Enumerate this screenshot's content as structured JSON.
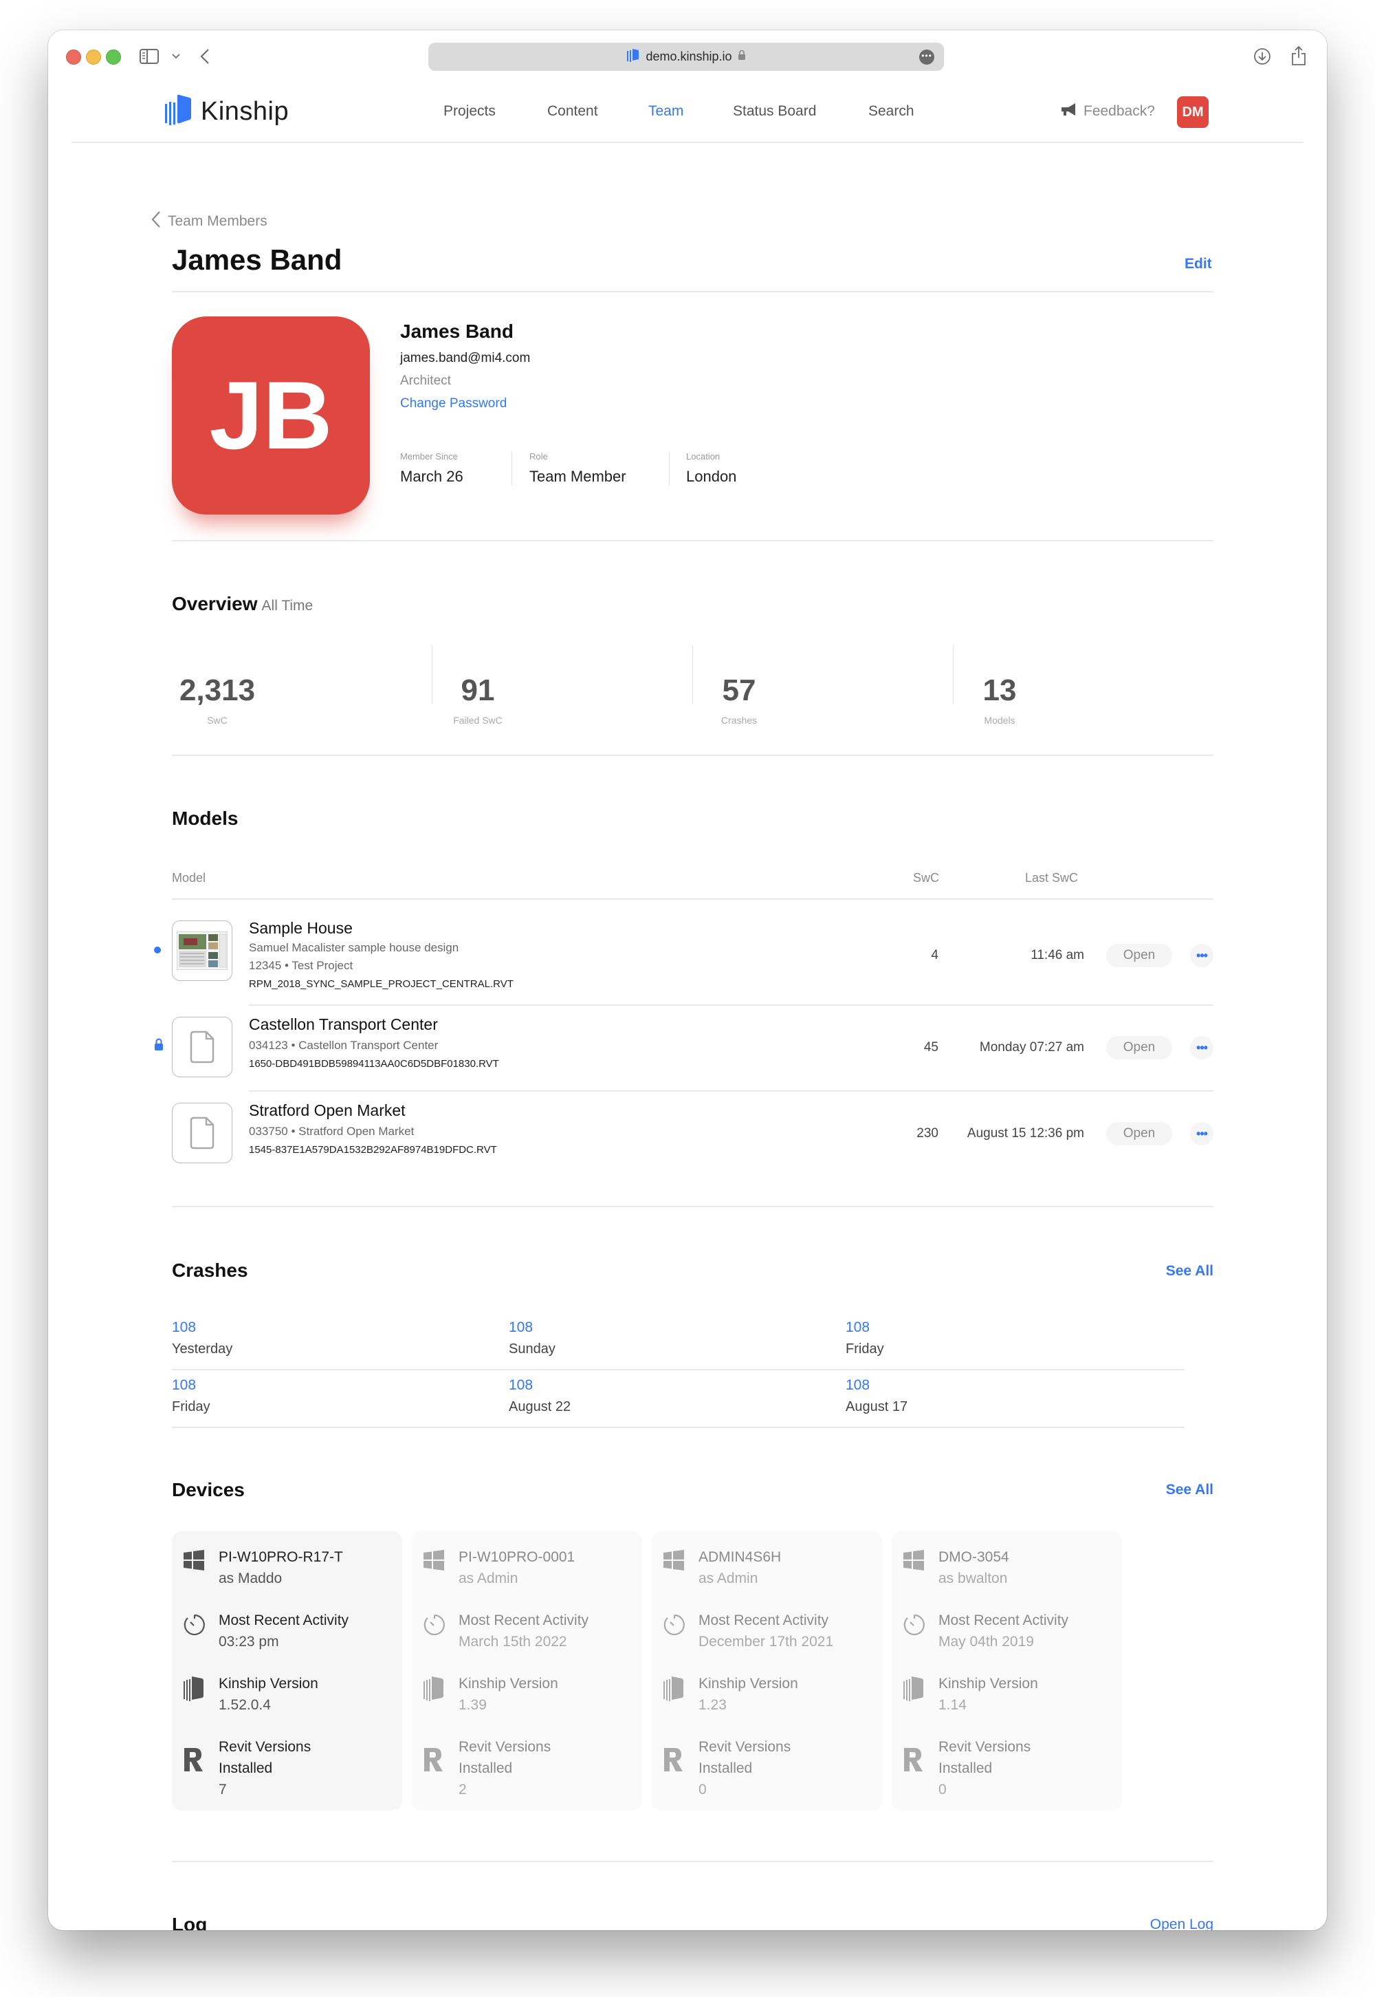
{
  "browser": {
    "url": "demo.kinship.io",
    "icons": [
      "sidebar-icon",
      "chevron-down-icon",
      "back-icon",
      "lock-icon",
      "more-icon",
      "download-icon",
      "share-icon",
      "new-tab-icon"
    ]
  },
  "brand": {
    "name": "Kinship",
    "accent": "#3478f6"
  },
  "nav": {
    "items": [
      {
        "label": "Projects",
        "active": false
      },
      {
        "label": "Content",
        "active": false
      },
      {
        "label": "Team",
        "active": true
      },
      {
        "label": "Status Board",
        "active": false
      },
      {
        "label": "Search",
        "active": false
      }
    ],
    "feedback": "Feedback?",
    "user_initials": "DM"
  },
  "header": {
    "breadcrumb": "Team Members",
    "title": "James Band",
    "edit": "Edit"
  },
  "profile": {
    "initials": "JB",
    "avatar_color": "#df4840",
    "name": "James Band",
    "email": "james.band@mi4.com",
    "job_title": "Architect",
    "change_password": "Change Password",
    "meta": [
      {
        "label": "Member Since",
        "value": "March 26"
      },
      {
        "label": "Role",
        "value": "Team Member"
      },
      {
        "label": "Location",
        "value": "London"
      }
    ]
  },
  "overview": {
    "title": "Overview",
    "subtitle": "All Time",
    "stats": [
      {
        "value": "2,313",
        "label": "SwC"
      },
      {
        "value": "91",
        "label": "Failed SwC"
      },
      {
        "value": "57",
        "label": "Crashes"
      },
      {
        "value": "13",
        "label": "Models"
      }
    ]
  },
  "models": {
    "title": "Models",
    "columns": {
      "model": "Model",
      "swc": "SwC",
      "last_swc": "Last SwC"
    },
    "open_label": "Open",
    "rows": [
      {
        "name": "Sample House",
        "description": "Samuel Macalister sample house design",
        "project": "12345 • Test Project",
        "file": "RPM_2018_SYNC_SAMPLE_PROJECT_CENTRAL.RVT",
        "swc": "4",
        "last_swc": "11:46 am",
        "indicator": "active-dot",
        "thumbnail": "preview"
      },
      {
        "name": "Castellon Transport Center",
        "project": "034123 • Castellon Transport Center",
        "file": "1650-DBD491BDB59894113AA0C6D5DBF01830.RVT",
        "swc": "45",
        "last_swc": "Monday 07:27 am",
        "indicator": "lock",
        "thumbnail": "file-icon"
      },
      {
        "name": "Stratford Open Market",
        "project": "033750 • Stratford Open Market",
        "file": "1545-837E1A579DA1532B292AF8974B19DFDC.RVT",
        "swc": "230",
        "last_swc": "August 15 12:36 pm",
        "indicator": "none",
        "thumbnail": "file-icon"
      }
    ]
  },
  "crashes": {
    "title": "Crashes",
    "see_all": "See All",
    "items": [
      {
        "value": "108",
        "label": "Yesterday"
      },
      {
        "value": "108",
        "label": "Sunday"
      },
      {
        "value": "108",
        "label": "Friday"
      },
      {
        "value": "108",
        "label": "Friday"
      },
      {
        "value": "108",
        "label": "August 22"
      },
      {
        "value": "108",
        "label": "August 17"
      }
    ]
  },
  "devices": {
    "title": "Devices",
    "see_all": "See All",
    "activity_label": "Most Recent Activity",
    "kinship_label": "Kinship Version",
    "revit_label_1": "Revit Versions",
    "revit_label_2": "Installed",
    "items": [
      {
        "name": "PI-W10PRO-R17-T",
        "user": "as Maddo",
        "activity": "03:23 pm",
        "kinship_version": "1.52.0.4",
        "revit_count": "7",
        "dimmed": false
      },
      {
        "name": "PI-W10PRO-0001",
        "user": "as Admin",
        "activity": "March 15th 2022",
        "kinship_version": "1.39",
        "revit_count": "2",
        "dimmed": true
      },
      {
        "name": "ADMIN4S6H",
        "user": "as Admin",
        "activity": "December 17th 2021",
        "kinship_version": "1.23",
        "revit_count": "0",
        "dimmed": true
      },
      {
        "name": "DMO-3054",
        "user": "as bwalton",
        "activity": "May 04th 2019",
        "kinship_version": "1.14",
        "revit_count": "0",
        "dimmed": true
      }
    ]
  },
  "log": {
    "title": "Log",
    "open": "Open Log"
  }
}
